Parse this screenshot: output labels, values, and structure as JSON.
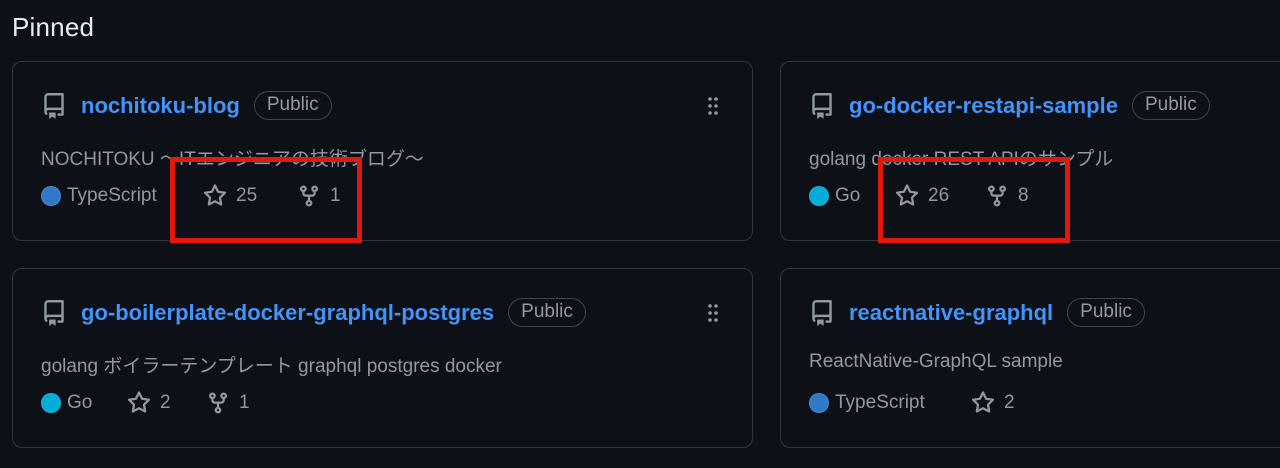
{
  "section_title": "Pinned",
  "colors": {
    "background": "#0d1117",
    "card_border": "#30363d",
    "link": "#4493f8",
    "muted": "#9198a1",
    "highlight_box": "#e0180f"
  },
  "icons": {
    "repo": "repo-icon",
    "star": "star-icon",
    "fork": "fork-icon",
    "drag": "grabber-icon"
  },
  "cards": [
    {
      "name": "nochitoku-blog",
      "visibility": "Public",
      "description": "NOCHITOKU 〜ITエンジニアの技術ブログ〜",
      "language": "TypeScript",
      "language_color": "#3178c6",
      "stars": "25",
      "forks": "1",
      "highlighted": true
    },
    {
      "name": "go-docker-restapi-sample",
      "visibility": "Public",
      "description": "golang docker REST APIのサンプル",
      "language": "Go",
      "language_color": "#00add8",
      "stars": "26",
      "forks": "8",
      "highlighted": true
    },
    {
      "name": "go-boilerplate-docker-graphql-postgres",
      "visibility": "Public",
      "description": "golang ボイラーテンプレート graphql postgres docker",
      "language": "Go",
      "language_color": "#00add8",
      "stars": "2",
      "forks": "1",
      "highlighted": false
    },
    {
      "name": "reactnative-graphql",
      "visibility": "Public",
      "description": "ReactNative-GraphQL sample",
      "language": "TypeScript",
      "language_color": "#3178c6",
      "stars": "2",
      "highlighted": false
    }
  ]
}
